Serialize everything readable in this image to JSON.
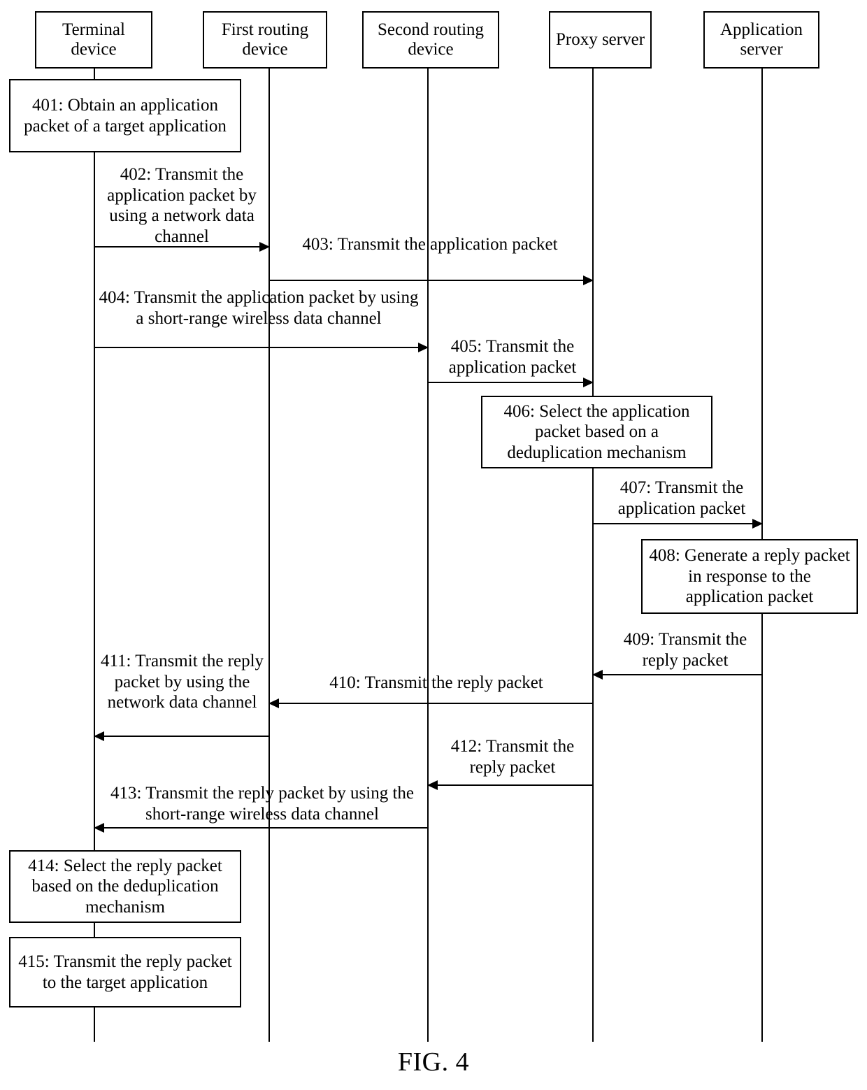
{
  "figure": {
    "caption": "FIG. 4"
  },
  "participants": [
    {
      "id": "terminal-device",
      "label": "Terminal device"
    },
    {
      "id": "first-routing-device",
      "label": "First routing device"
    },
    {
      "id": "second-routing-device",
      "label": "Second routing device"
    },
    {
      "id": "proxy-server",
      "label": "Proxy server"
    },
    {
      "id": "application-server",
      "label": "Application server"
    }
  ],
  "steps": [
    {
      "id": "401",
      "kind": "action",
      "actor": "terminal-device",
      "label": "401: Obtain an application packet of a target application"
    },
    {
      "id": "402",
      "kind": "message",
      "from": "terminal-device",
      "to": "first-routing-device",
      "direction": "right",
      "label": "402: Transmit the application packet by using a network data channel"
    },
    {
      "id": "403",
      "kind": "message",
      "from": "first-routing-device",
      "to": "proxy-server",
      "direction": "right",
      "label": "403: Transmit the application packet"
    },
    {
      "id": "404",
      "kind": "message",
      "from": "terminal-device",
      "to": "second-routing-device",
      "direction": "right",
      "label": "404: Transmit the application packet by using a short-range wireless data channel"
    },
    {
      "id": "405",
      "kind": "message",
      "from": "second-routing-device",
      "to": "proxy-server",
      "direction": "right",
      "label": "405: Transmit the application packet"
    },
    {
      "id": "406",
      "kind": "action",
      "actor": "proxy-server",
      "label": "406: Select the application packet based on a deduplication mechanism"
    },
    {
      "id": "407",
      "kind": "message",
      "from": "proxy-server",
      "to": "application-server",
      "direction": "right",
      "label": "407: Transmit the application packet"
    },
    {
      "id": "408",
      "kind": "action",
      "actor": "application-server",
      "label": "408: Generate a reply packet in response to the application packet"
    },
    {
      "id": "409",
      "kind": "message",
      "from": "application-server",
      "to": "proxy-server",
      "direction": "left",
      "label": "409: Transmit the reply packet"
    },
    {
      "id": "410",
      "kind": "message",
      "from": "proxy-server",
      "to": "first-routing-device",
      "direction": "left",
      "label": "410: Transmit the reply packet"
    },
    {
      "id": "411",
      "kind": "message",
      "from": "first-routing-device",
      "to": "terminal-device",
      "direction": "left",
      "label": "411: Transmit the reply packet by using the network data channel"
    },
    {
      "id": "412",
      "kind": "message",
      "from": "proxy-server",
      "to": "second-routing-device",
      "direction": "left",
      "label": "412: Transmit the reply packet"
    },
    {
      "id": "413",
      "kind": "message",
      "from": "second-routing-device",
      "to": "terminal-device",
      "direction": "left",
      "label": "413: Transmit the reply packet by using the short-range wireless data channel"
    },
    {
      "id": "414",
      "kind": "action",
      "actor": "terminal-device",
      "label": "414: Select the reply packet based on the deduplication mechanism"
    },
    {
      "id": "415",
      "kind": "action",
      "actor": "terminal-device",
      "label": "415: Transmit the reply packet to the target application"
    }
  ]
}
